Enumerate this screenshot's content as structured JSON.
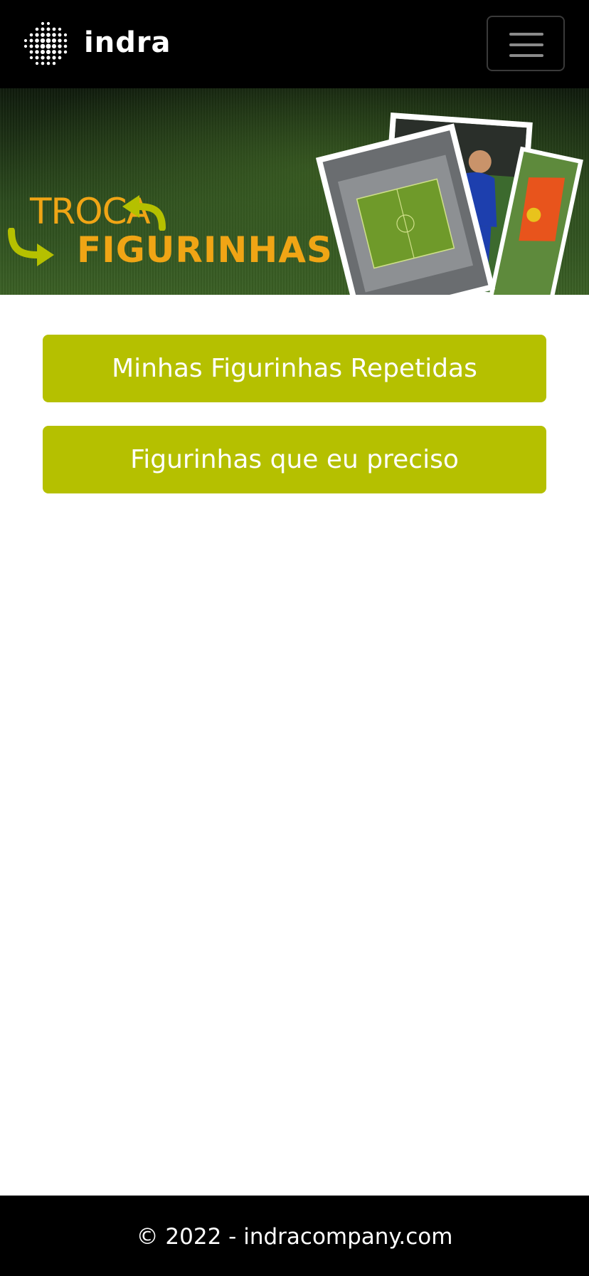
{
  "navbar": {
    "brand": "indra",
    "menu_icon": "hamburger-menu-icon"
  },
  "banner": {
    "title_line1": "TROCA",
    "title_line2": "FIGURINHAS",
    "accent_color": "#f0a515",
    "arrow_color": "#b5c000"
  },
  "actions": {
    "button1_label": "Minhas Figurinhas Repetidas",
    "button2_label": "Figurinhas que eu preciso",
    "button_color": "#b5c000"
  },
  "footer": {
    "text": "© 2022 - indracompany.com"
  }
}
